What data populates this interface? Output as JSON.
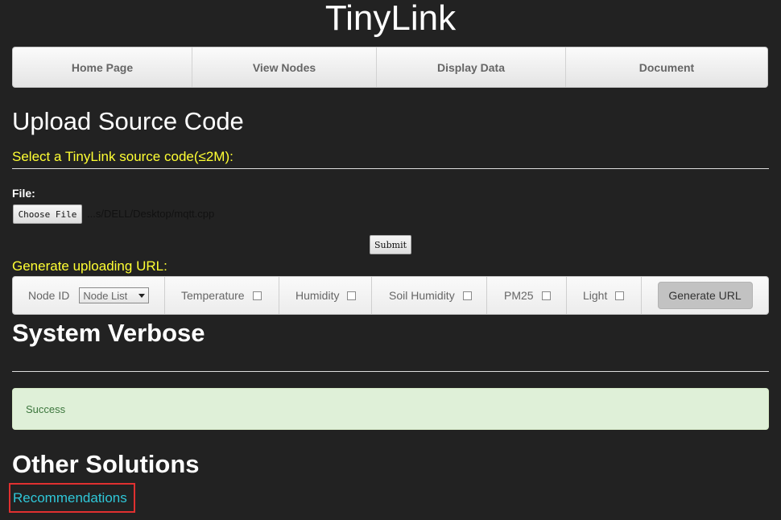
{
  "site": {
    "title": "TinyLink"
  },
  "nav": {
    "items": [
      {
        "label": "Home Page"
      },
      {
        "label": "View Nodes"
      },
      {
        "label": "Display Data"
      },
      {
        "label": "Document"
      }
    ]
  },
  "upload": {
    "heading": "Upload Source Code",
    "select_label": "Select a TinyLink source code(≤2M):",
    "file_label": "File:",
    "choose_button": "Choose File",
    "file_path": "...s/DELL/Desktop/mqtt.cpp",
    "submit_button": "Submit"
  },
  "url_generator": {
    "label": "Generate uploading URL:",
    "node_id_label": "Node ID",
    "node_select_value": "Node List",
    "options": [
      {
        "label": "Temperature",
        "checked": false
      },
      {
        "label": "Humidity",
        "checked": false
      },
      {
        "label": "Soil Humidity",
        "checked": false
      },
      {
        "label": "PM25",
        "checked": false
      },
      {
        "label": "Light",
        "checked": false
      }
    ],
    "generate_button": "Generate URL"
  },
  "verbose": {
    "heading": "System Verbose",
    "status_text": "Success",
    "status_color": "#dff0d8"
  },
  "other": {
    "heading": "Other Solutions",
    "link": "Recommendations"
  }
}
